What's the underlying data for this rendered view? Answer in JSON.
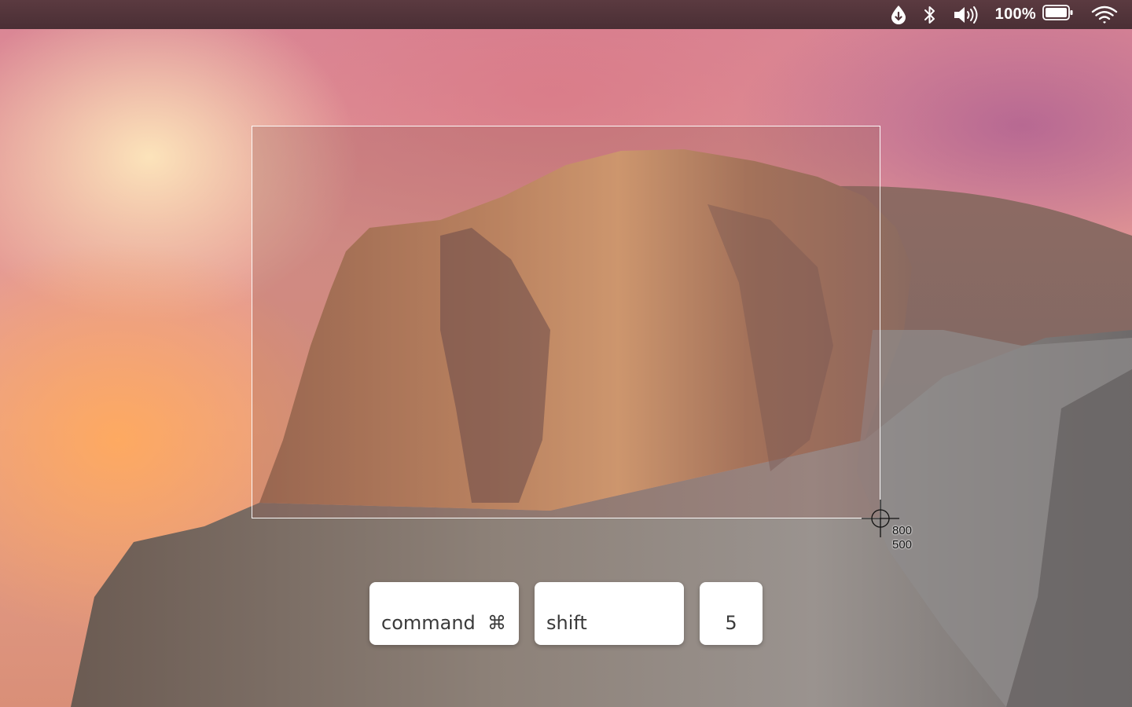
{
  "menubar": {
    "status_icons": [
      "droplet-download-icon",
      "bluetooth-icon",
      "volume-icon"
    ],
    "battery_percent": "100%",
    "battery_level": 1.0,
    "wifi_icon": "wifi-icon",
    "background_color": "#4f3238"
  },
  "selection": {
    "width_readout": "800",
    "height_readout": "500",
    "border_color": "#ffffff"
  },
  "keys": {
    "command_label": "command",
    "command_symbol": "⌘",
    "shift_label": "shift",
    "five_label": "5"
  }
}
